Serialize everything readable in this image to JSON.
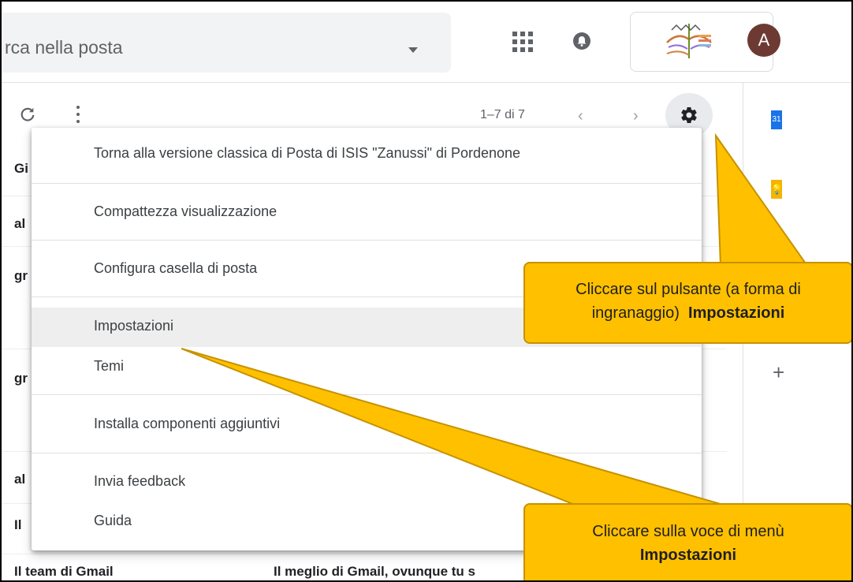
{
  "search": {
    "text": "rca nella posta"
  },
  "profile": {
    "avatar_letter": "A"
  },
  "toolbar": {
    "pager": "1–7 di 7"
  },
  "calendar_icon_text": "31",
  "rows": {
    "r1": "Gi",
    "r2": "al",
    "r3": "gr",
    "r4": "gr",
    "r5": "al",
    "r6": "Il",
    "r7": "Il team di Gmail",
    "r7_subject": "Il meglio di Gmail, ovunque tu s"
  },
  "menu": {
    "items": [
      {
        "label": "Torna alla versione classica di Posta di ISIS \"Zanussi\" di Pordenone"
      },
      {
        "label": "Compattezza visualizzazione"
      },
      {
        "label": "Configura casella di posta"
      },
      {
        "label": "Impostazioni"
      },
      {
        "label": "Temi"
      },
      {
        "label": "Installa componenti aggiuntivi"
      },
      {
        "label": "Invia feedback"
      },
      {
        "label": "Guida"
      }
    ]
  },
  "callouts": {
    "gear": {
      "line1": "Cliccare sul pulsante (a forma di",
      "line2": "ingranaggio)",
      "bold": "Impostazioni"
    },
    "menu": {
      "line1": "Cliccare sulla voce di menù",
      "bold": "Impostazioni"
    }
  },
  "colors": {
    "callout_fill": "#ffc000",
    "callout_border": "#c69200",
    "avatar": "#6d3a33"
  },
  "icons": [
    "search-dropdown-icon",
    "apps-grid-icon",
    "notification-bell-icon",
    "school-logo",
    "refresh-icon",
    "more-vert-icon",
    "chevron-left-icon",
    "chevron-right-icon",
    "settings-gear-icon",
    "calendar-icon",
    "keep-icon",
    "plus-icon"
  ]
}
